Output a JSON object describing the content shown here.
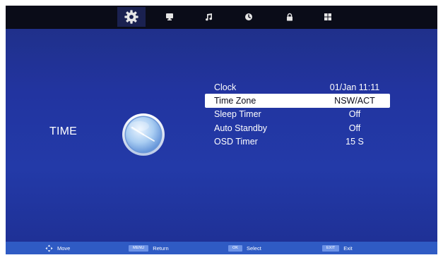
{
  "topbar": {
    "tabs": [
      {
        "icon": "gear-icon",
        "active": true
      },
      {
        "icon": "monitor-icon",
        "active": false
      },
      {
        "icon": "music-note-icon",
        "active": false
      },
      {
        "icon": "clock-icon",
        "active": false
      },
      {
        "icon": "lock-icon",
        "active": false
      },
      {
        "icon": "grid-icon",
        "active": false
      }
    ]
  },
  "page": {
    "title": "TIME"
  },
  "menu": {
    "items": [
      {
        "label": "Clock",
        "value": "01/Jan 11:11"
      },
      {
        "label": "Time Zone",
        "value": "NSW/ACT",
        "selected": true
      },
      {
        "label": "Sleep Timer",
        "value": "Off"
      },
      {
        "label": "Auto Standby",
        "value": "Off"
      },
      {
        "label": "OSD Timer",
        "value": "15 S"
      }
    ]
  },
  "hints": {
    "move": {
      "label": "Move"
    },
    "return": {
      "key": "MENU",
      "label": "Return"
    },
    "select": {
      "key": "OK",
      "label": "Select"
    },
    "exit": {
      "key": "EXIT",
      "label": "Exit"
    }
  },
  "colors": {
    "background": "#2234a0",
    "topbar": "#0a0c18",
    "hintbar": "#2f5bc4",
    "selected_row": "#ffffff"
  }
}
